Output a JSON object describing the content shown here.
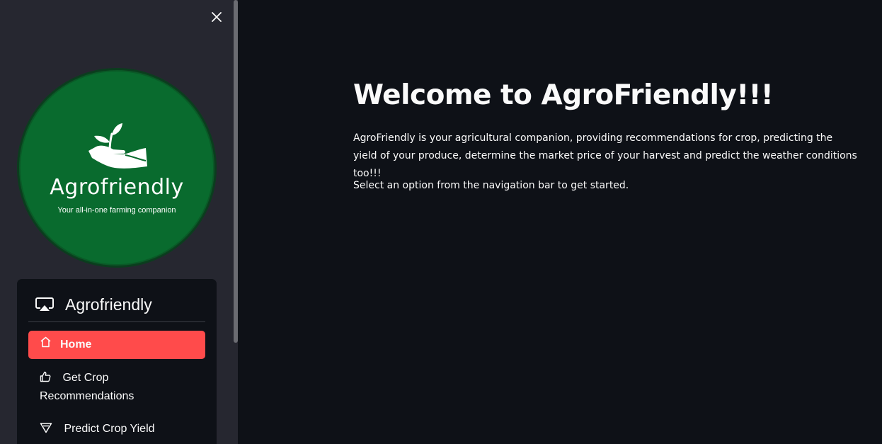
{
  "sidebar": {
    "close_icon": "close-icon",
    "logo": {
      "name": "Agrofriendly",
      "tagline": "Your all-in-one farming companion",
      "color": "#096b2e"
    },
    "nav": {
      "title": "Agrofriendly",
      "title_icon": "screen-cast-icon",
      "items": [
        {
          "label": "Home",
          "icon": "house-icon",
          "active": true
        },
        {
          "label": "Get Crop Recommendations",
          "icon": "thumbs-up-icon",
          "active": false
        },
        {
          "label": "Predict Crop Yield",
          "icon": "triangle-down-icon",
          "active": false
        }
      ],
      "active_color": "#ff4b4b"
    }
  },
  "main": {
    "title": "Welcome to AgroFriendly!!!",
    "paragraphs": [
      "AgroFriendly is your agricultural companion, providing recommendations for crop, predicting the yield of your produce, determine the market price of your harvest and predict the weather conditions too!!!",
      "Select an option from the navigation bar to get started."
    ]
  }
}
